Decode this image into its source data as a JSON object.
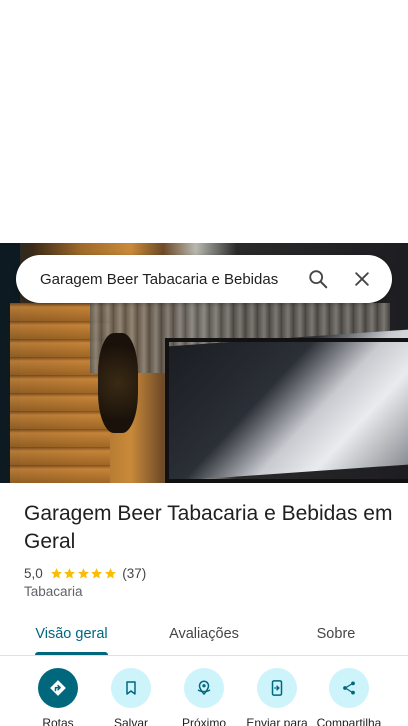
{
  "search": {
    "query": "Garagem Beer Tabacaria e Bebidas"
  },
  "place": {
    "name": "Garagem Beer Tabacaria e Bebidas em Geral",
    "rating": "5,0",
    "stars": 5,
    "review_count": "(37)",
    "category": "Tabacaria"
  },
  "tabs": [
    {
      "label": "Visão geral",
      "active": true
    },
    {
      "label": "Avaliações",
      "active": false
    },
    {
      "label": "Sobre",
      "active": false
    }
  ],
  "actions": [
    {
      "label": "Rotas",
      "icon": "directions-icon"
    },
    {
      "label": "Salvar",
      "icon": "bookmark-icon"
    },
    {
      "label": "Próximo",
      "icon": "nearby-icon"
    },
    {
      "label": "Enviar para",
      "icon": "send-to-phone-icon"
    },
    {
      "label": "Compartilha",
      "icon": "share-icon"
    }
  ],
  "colors": {
    "accent": "#00677d",
    "action_bg": "#cdf3fb",
    "star": "#fbbc04"
  }
}
